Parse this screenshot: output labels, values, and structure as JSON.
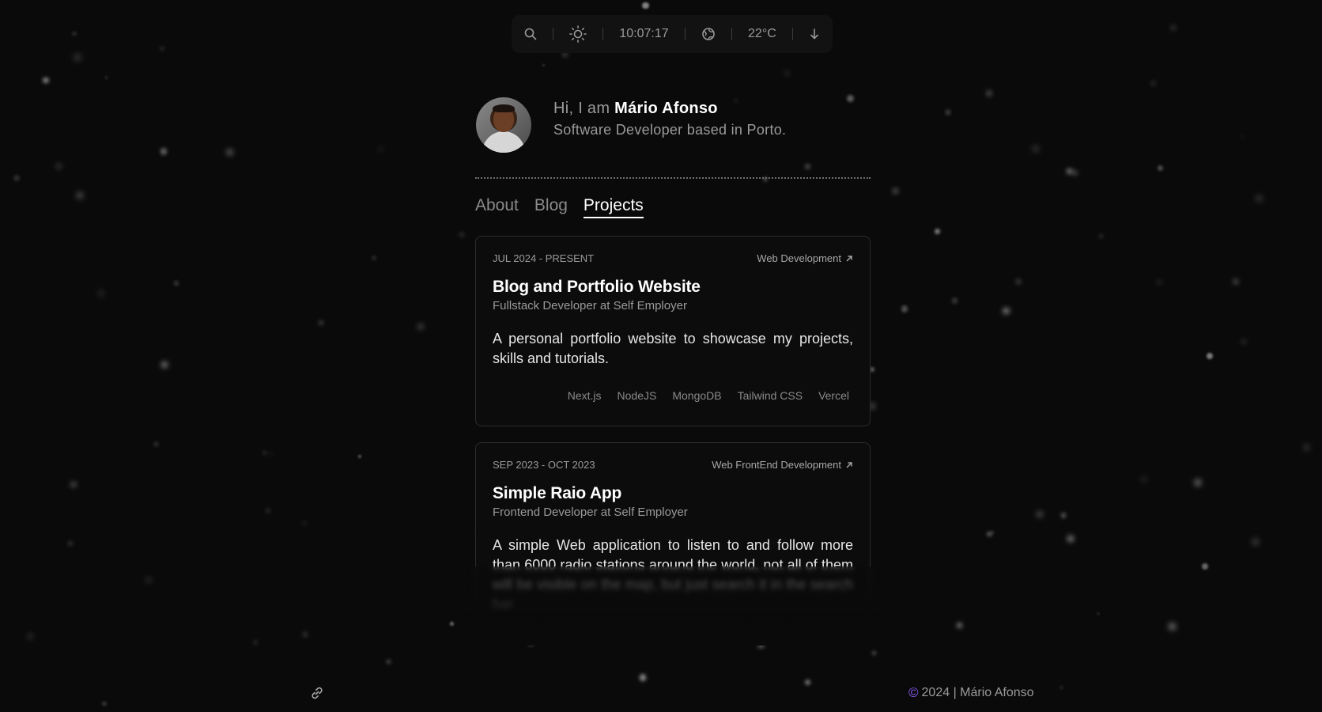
{
  "topbar": {
    "search_icon": "search-icon",
    "theme_icon": "sun-icon",
    "time": "10:07:17",
    "globe_icon": "globe-icon",
    "temperature": "22°C",
    "scroll_icon": "arrow-down-icon"
  },
  "profile": {
    "greeting_prefix": "Hi, I am",
    "name": "Mário Afonso",
    "tagline": "Software Developer based in Porto."
  },
  "tabs": [
    {
      "label": "About",
      "active": false
    },
    {
      "label": "Blog",
      "active": false
    },
    {
      "label": "Projects",
      "active": true
    }
  ],
  "projects": [
    {
      "date": "JUL 2024 - PRESENT",
      "category": "Web Development",
      "title": "Blog and Portfolio Website",
      "role": "Fullstack Developer at Self Employer",
      "description": "A personal portfolio website to showcase my projects, skills and tutorials.",
      "tags": [
        "Next.js",
        "NodeJS",
        "MongoDB",
        "Tailwind CSS",
        "Vercel"
      ]
    },
    {
      "date": "SEP 2023 - OCT 2023",
      "category": "Web FrontEnd Development",
      "title": "Simple Raio App",
      "role": "Frontend Developer at Self Employer",
      "description": "A simple Web application to listen to and follow more than 6000 radio stations around the world, not all of them will be visible on the map, but just search it in the search bar"
    }
  ],
  "footer": {
    "copyright_symbol": "©",
    "text": "2024 | Mário Afonso",
    "link_icon": "link-icon"
  },
  "colors": {
    "background": "#0a0a0a",
    "accent": "#8b5cf6",
    "text_primary": "#ffffff",
    "text_muted": "#9a9a9a"
  }
}
